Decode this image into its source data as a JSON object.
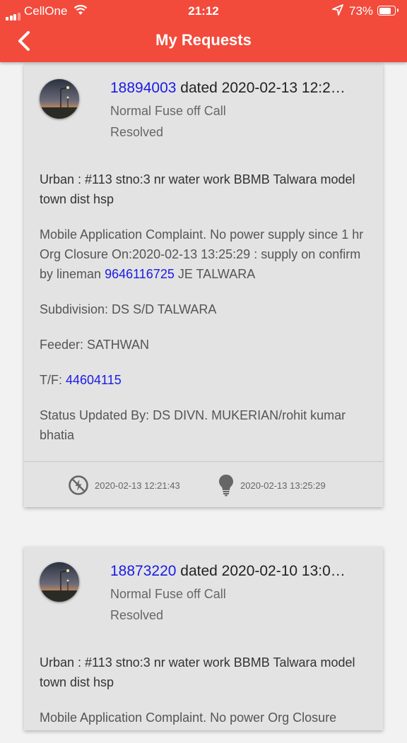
{
  "status_bar": {
    "carrier": "CellOne",
    "time": "21:12",
    "battery": "73%"
  },
  "header": {
    "title": "My Requests"
  },
  "requests": [
    {
      "id": "18894003",
      "dated_label": " dated ",
      "date": "2020-02-13 12:2…",
      "type": "Normal Fuse off Call",
      "status": "Resolved",
      "address": "Urban : #113 stno:3 nr water work BBMB Talwara model town dist hsp",
      "complaint_before": "Mobile Application Complaint. No power supply since 1 hr Org Closure On:2020-02-13 13:25:29 : supply on confirm by lineman ",
      "complaint_phone": "9646116725",
      "complaint_after": " JE TALWARA",
      "subdivision": "Subdivision: DS S/D TALWARA",
      "feeder": "Feeder: SATHWAN",
      "tf_label": "T/F: ",
      "tf_value": "44604115",
      "updated_by": "Status Updated By: DS DIVN. MUKERIAN/rohit kumar bhatia",
      "reported_at": "2020-02-13 12:21:43",
      "resolved_at": "2020-02-13 13:25:29"
    },
    {
      "id": "18873220",
      "dated_label": " dated ",
      "date": "2020-02-10 13:0…",
      "type": "Normal Fuse off Call",
      "status": "Resolved",
      "address": "Urban : #113 stno:3 nr water work BBMB Talwara model town dist hsp",
      "complaint_partial": "Mobile Application Complaint. No power Org Closure"
    }
  ],
  "colors": {
    "header": "#f24b3c",
    "link": "#1a1ae6",
    "card": "#e3e3e3"
  }
}
